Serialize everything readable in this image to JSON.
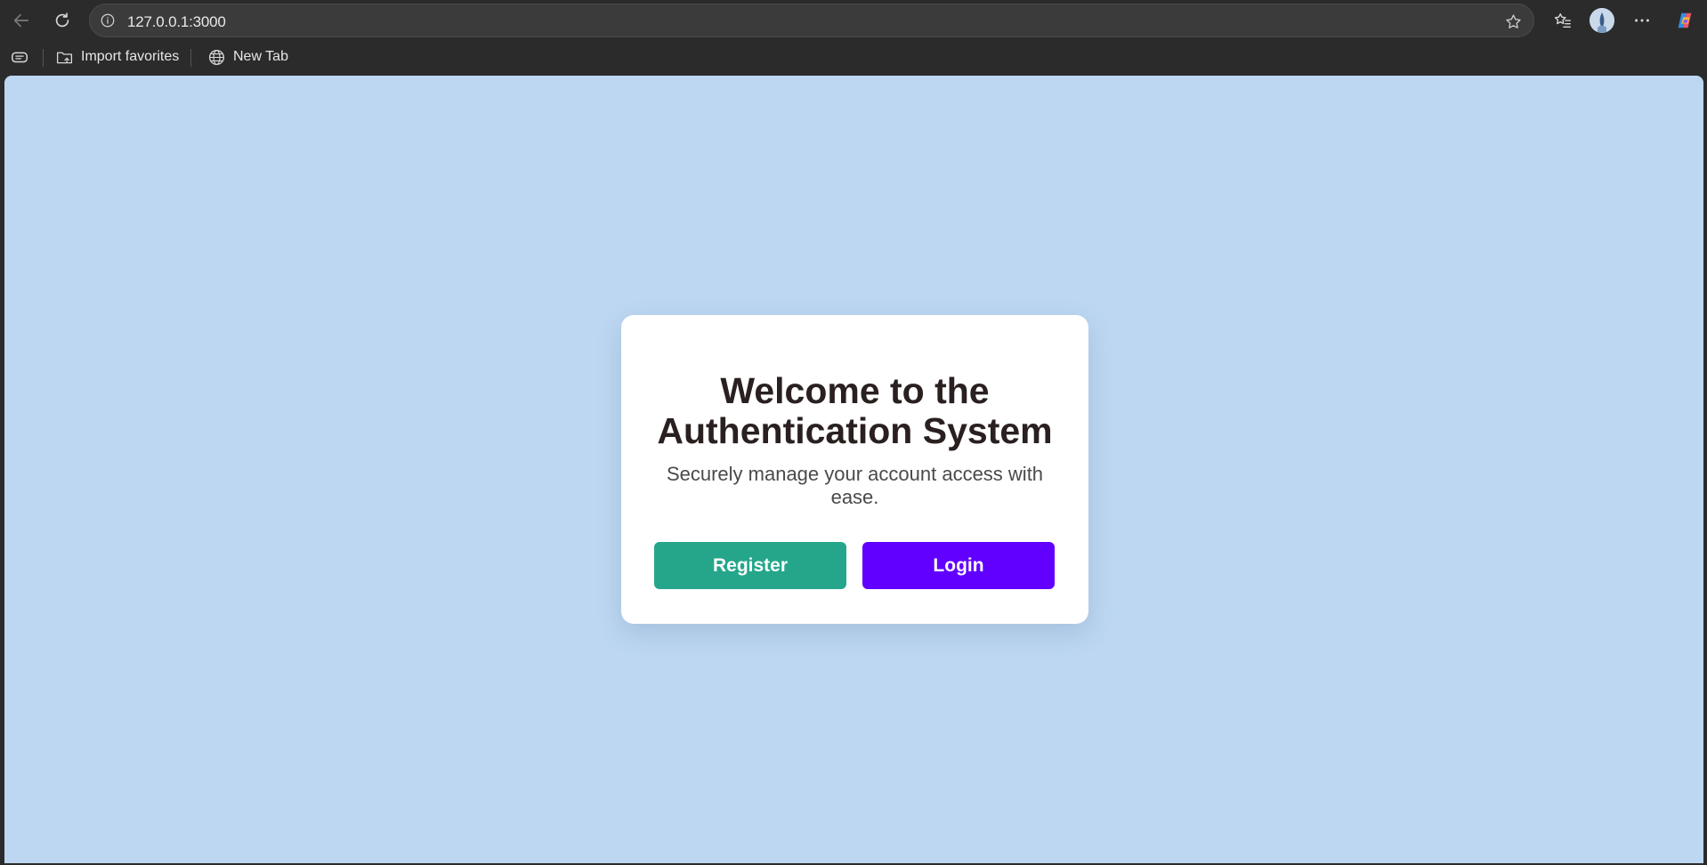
{
  "browser": {
    "url": "127.0.0.1:3000",
    "favorites": [
      {
        "label": "Import favorites",
        "icon": "folder-import-icon"
      },
      {
        "label": "New Tab",
        "icon": "globe-icon"
      }
    ]
  },
  "page": {
    "background": "#bdd7f2",
    "card": {
      "title": "Welcome to the Authentication System",
      "subtitle": "Securely manage your account access with ease.",
      "register_label": "Register",
      "login_label": "Login",
      "register_color": "#25a68b",
      "login_color": "#6200ff"
    }
  }
}
